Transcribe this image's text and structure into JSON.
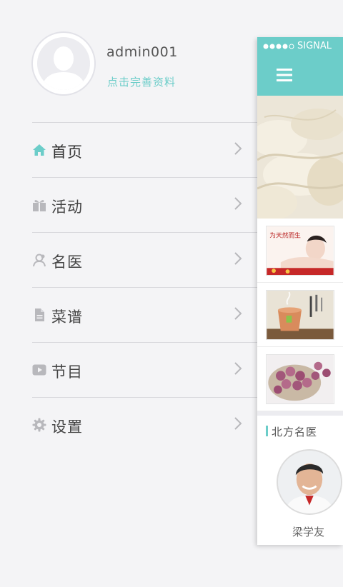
{
  "profile": {
    "username": "admin001",
    "edit_profile": "点击完善资料"
  },
  "menu": [
    {
      "label": "首页",
      "icon": "home-icon"
    },
    {
      "label": "活动",
      "icon": "gift-icon"
    },
    {
      "label": "名医",
      "icon": "doctor-icon"
    },
    {
      "label": "菜谱",
      "icon": "document-icon"
    },
    {
      "label": "节目",
      "icon": "play-icon"
    },
    {
      "label": "设置",
      "icon": "gear-icon"
    }
  ],
  "preview": {
    "status_text": "SIGNAL",
    "section_title": "北方名医",
    "doctor_name": "梁学友",
    "thumb_caption": "为天然而生"
  },
  "colors": {
    "accent": "#6ccdc9",
    "text": "#444444",
    "icon_gray": "#b8b8bc",
    "background": "#f4f4f6"
  }
}
